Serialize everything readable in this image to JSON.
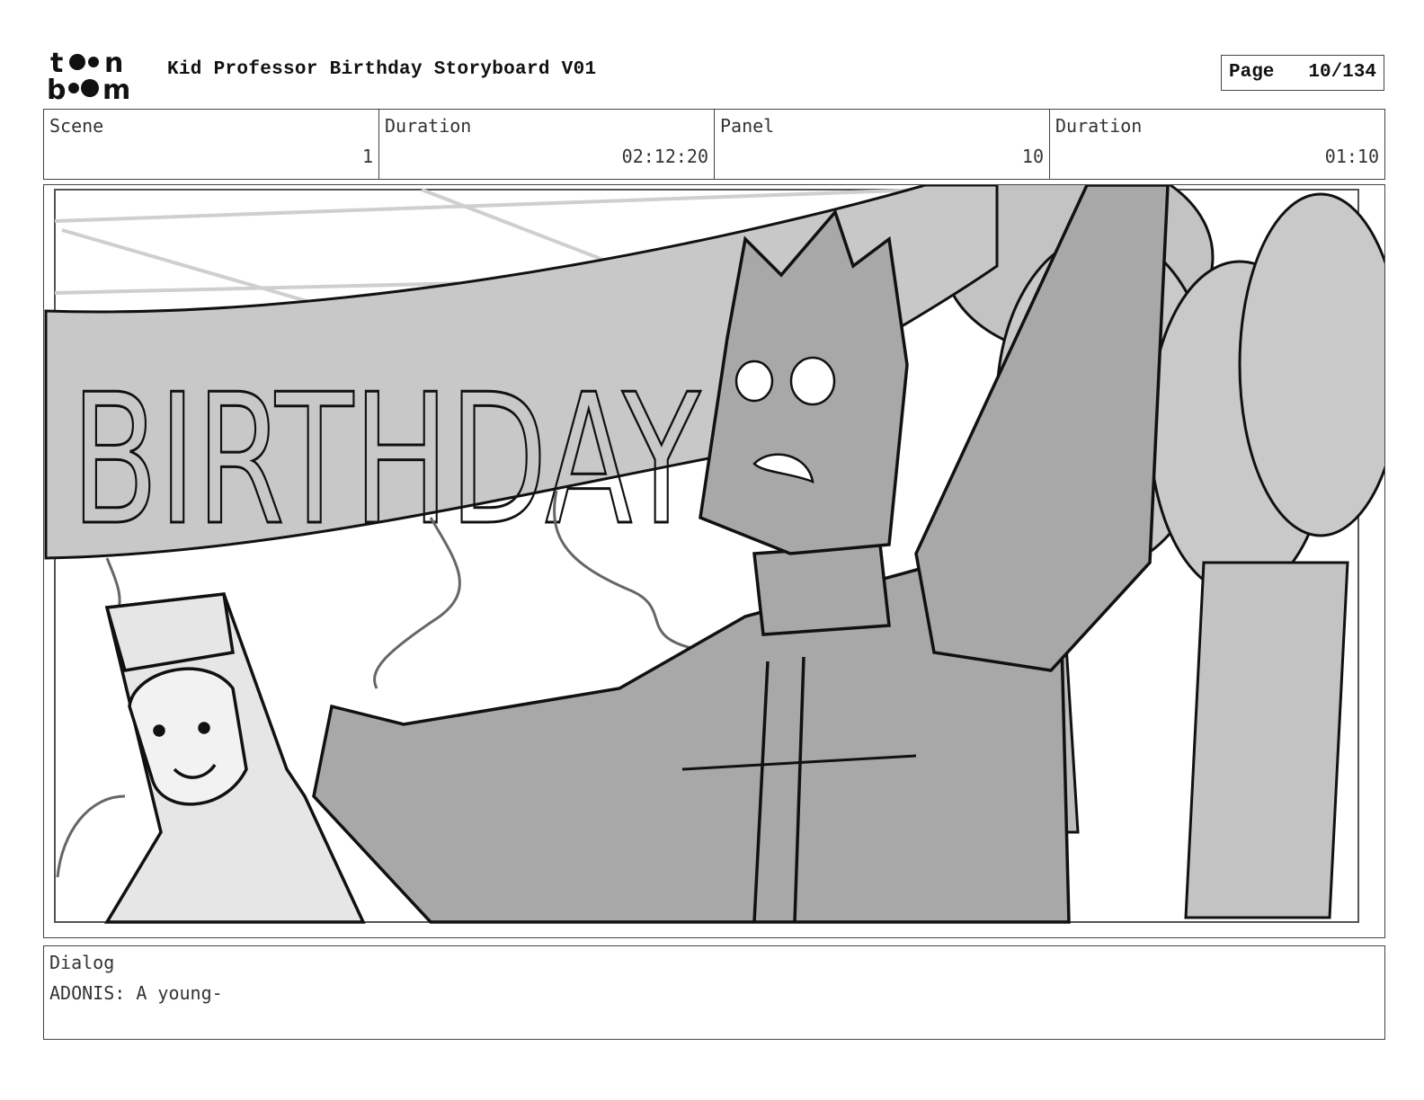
{
  "header": {
    "title": "Kid Professor Birthday Storyboard V01",
    "page_label": "Page",
    "page_value": "10/134"
  },
  "info": {
    "scene_label": "Scene",
    "scene_value": "1",
    "scene_duration_label": "Duration",
    "scene_duration_value": "02:12:20",
    "panel_label": "Panel",
    "panel_value": "10",
    "panel_duration_label": "Duration",
    "panel_duration_value": "01:10"
  },
  "panel": {
    "banner_text": "BIRTHDAY"
  },
  "dialog": {
    "label": "Dialog",
    "text": "ADONIS: A young-"
  }
}
